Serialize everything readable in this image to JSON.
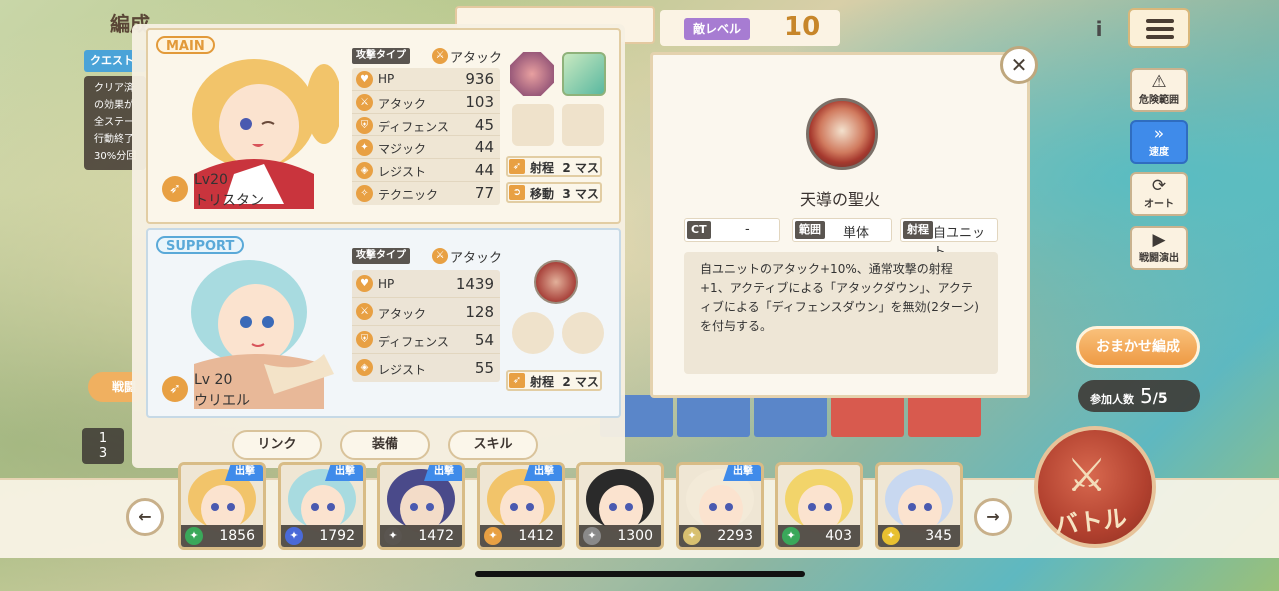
{
  "header": {
    "title": "編成",
    "quest_chip": "クエスト",
    "clear_text": "クリア済\nの効果が\n全ステー\n行動終了\n30%分回",
    "battle_small": "戦闘",
    "page_indicator_top": "1",
    "page_indicator_bottom": "3"
  },
  "enemy": {
    "label": "敵レベル",
    "value": "10"
  },
  "side_buttons": [
    {
      "icon": "warning-icon",
      "label": "危険範囲"
    },
    {
      "icon": "fast-forward-icon",
      "label": "速度",
      "active": true
    },
    {
      "icon": "refresh-icon",
      "label": "オート"
    },
    {
      "icon": "play-icon",
      "label": "戦闘演出"
    }
  ],
  "auto_formation": "おまかせ編成",
  "participants": {
    "label": "参加人数",
    "current": "5",
    "total": "/5"
  },
  "battle_button": "バトル",
  "main_unit": {
    "role": "MAIN",
    "level": "Lv20",
    "name": "トリスタン",
    "attack_type_label": "攻撃タイプ",
    "attack_type": "アタック",
    "stats": [
      {
        "label": "HP",
        "value": "936"
      },
      {
        "label": "アタック",
        "value": "103"
      },
      {
        "label": "ディフェンス",
        "value": "45"
      },
      {
        "label": "マジック",
        "value": "44"
      },
      {
        "label": "レジスト",
        "value": "44"
      },
      {
        "label": "テクニック",
        "value": "77"
      }
    ],
    "range": "射程",
    "range_value": "2",
    "range_unit": "マス",
    "move": "移動",
    "move_value": "3",
    "move_unit": "マス"
  },
  "support_unit": {
    "role": "SUPPORT",
    "level": "Lv 20",
    "name": "ウリエル",
    "attack_type_label": "攻撃タイプ",
    "attack_type": "アタック",
    "stats": [
      {
        "label": "HP",
        "value": "1439"
      },
      {
        "label": "アタック",
        "value": "128"
      },
      {
        "label": "ディフェンス",
        "value": "54"
      },
      {
        "label": "レジスト",
        "value": "55"
      }
    ],
    "range": "射程",
    "range_value": "2",
    "range_unit": "マス"
  },
  "tabs": [
    "リンク",
    "装備",
    "スキル"
  ],
  "skill_detail": {
    "name": "天導の聖火",
    "ct_label": "CT",
    "ct_value": "-",
    "area_label": "範囲",
    "area_value": "単体",
    "range_label": "射程",
    "range_value": "自ユニット",
    "description": "自ユニットのアタック+10%、通常攻撃の射程+1、アクティブによる「アタックダウン」、アクティブによる「ディフェンスダウン」を無効(2ターン)を付与する。"
  },
  "roster": [
    {
      "power": "1856",
      "sortie": "出撃",
      "elem_color": "#3aa85a"
    },
    {
      "power": "1792",
      "sortie": "出撃",
      "elem_color": "#4a6ad8"
    },
    {
      "power": "1472",
      "sortie": "出撃",
      "elem_color": "#5a5550"
    },
    {
      "power": "1412",
      "sortie": "出撃",
      "elem_color": "#e8a043"
    },
    {
      "power": "1300",
      "sortie": "",
      "elem_color": "#8a8a8a"
    },
    {
      "power": "2293",
      "sortie": "出撃",
      "elem_color": "#d8c070"
    },
    {
      "power": "403",
      "sortie": "",
      "elem_color": "#3aa85a"
    },
    {
      "power": "345",
      "sortie": "",
      "elem_color": "#e8c030"
    }
  ],
  "colors": {
    "accent_blue": "#3f8bea",
    "accent_orange": "#e8a043",
    "battle_red": "#b2412f"
  }
}
